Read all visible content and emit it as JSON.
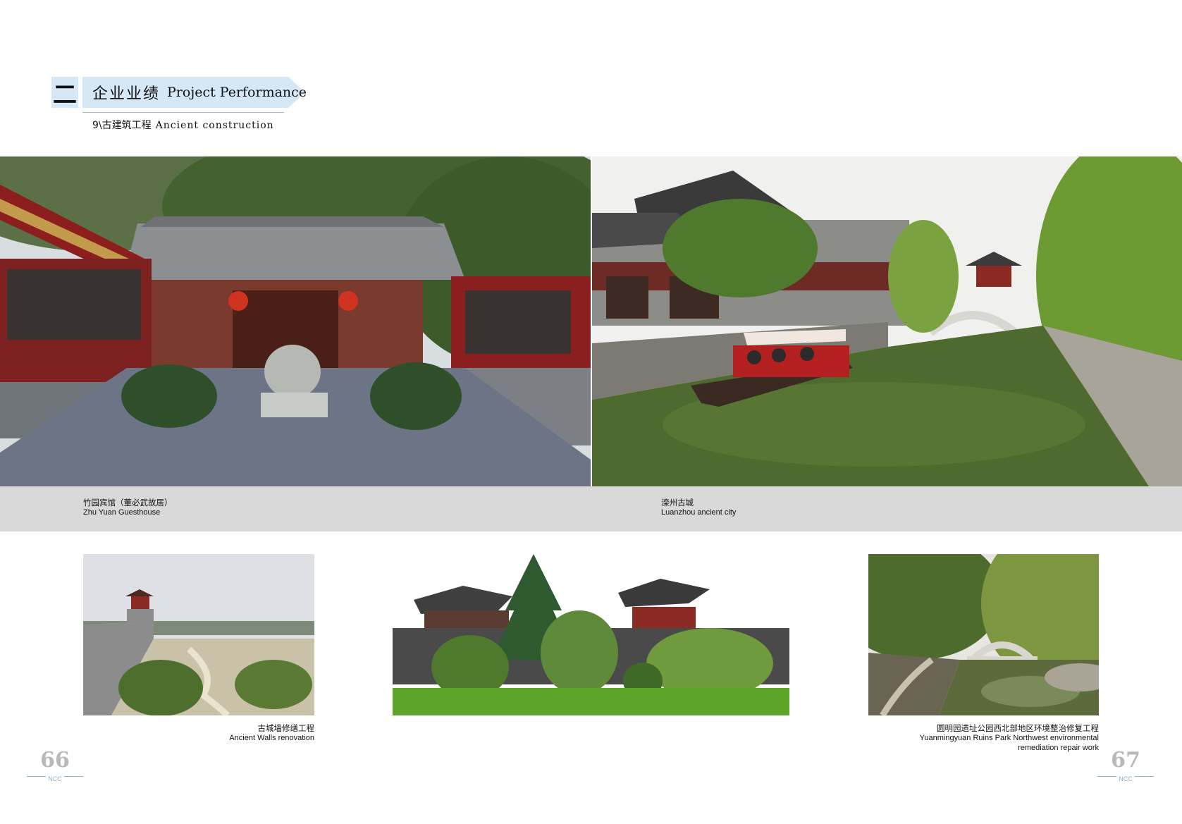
{
  "header": {
    "section_number": "二",
    "title_cn": "企业业绩",
    "title_en": "Project Performance",
    "sub_cn": "9\\古建筑工程",
    "sub_en": "Ancient construction"
  },
  "projects": [
    {
      "cn": "竹园宾馆（董必武故居）",
      "en": "Zhu Yuan Guesthouse",
      "image": "courtyard-house-photo"
    },
    {
      "cn": "滦州古城",
      "en": "Luanzhou ancient city",
      "image": "canal-town-photo"
    },
    {
      "cn": "古城墙修缮工程",
      "en": "Ancient Walls renovation",
      "image": "city-wall-photo"
    },
    {
      "cn": "",
      "en": "",
      "image": "pavilion-garden-photo"
    },
    {
      "cn": "圆明园遗址公园西北部地区环境整治修复工程",
      "en_line1": "Yuanmingyuan Ruins Park Northwest environmental",
      "en_line2": "remediation repair work",
      "image": "arch-bridge-photo"
    }
  ],
  "pages": {
    "left": {
      "number": "66",
      "tag": "NCC"
    },
    "right": {
      "number": "67",
      "tag": "NCC"
    }
  },
  "colors": {
    "header_blue": "#d6e8f6",
    "band_gray": "#d9d9d9",
    "rule_blue": "#8db3d3"
  }
}
